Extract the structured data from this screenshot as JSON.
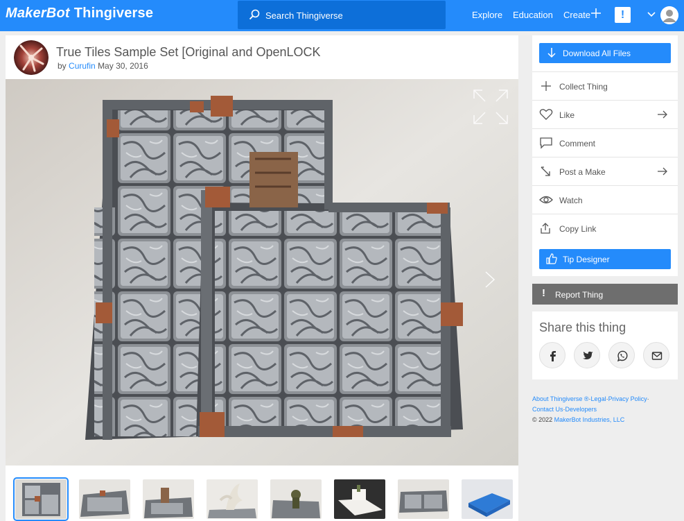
{
  "header": {
    "brand_left": "MakerBot",
    "brand_right": "Thingiverse",
    "search_placeholder": "Search Thingiverse",
    "nav": [
      "Explore",
      "Education",
      "Create"
    ],
    "alert_symbol": "!"
  },
  "thing": {
    "title": "True Tiles Sample Set [Original and OpenLOCK",
    "by": "by",
    "author": "Curufin",
    "date": "May 30, 2016"
  },
  "gallery": {
    "thumbnail_count": 8,
    "active_index": 0
  },
  "sidebar": {
    "download_label": "Download All Files",
    "actions": [
      {
        "label": "Collect Thing",
        "icon": "plus-icon"
      },
      {
        "label": "Like",
        "icon": "heart-icon"
      },
      {
        "label": "Comment",
        "icon": "comment-icon"
      },
      {
        "label": "Post a Make",
        "icon": "make-icon"
      },
      {
        "label": "Watch",
        "icon": "eye-icon"
      },
      {
        "label": "Copy Link",
        "icon": "share-icon"
      }
    ],
    "tip_label": "Tip Designer",
    "report_label": "Report Thing",
    "report_symbol": "!",
    "share_title": "Share this thing",
    "share_icons": [
      "facebook-icon",
      "twitter-icon",
      "whatsapp-icon",
      "email-icon"
    ]
  },
  "footer": {
    "line1_links": [
      "About Thingiverse",
      "®",
      "Legal",
      "Privacy Policy"
    ],
    "line2_links": [
      "Contact Us",
      "Developers"
    ],
    "copyright": "©  2022",
    "company": "MakerBot Industries, LLC"
  },
  "colors": {
    "brand_blue": "#248bfb",
    "search_bg": "#0d6fd9",
    "report_bg": "#6e6e6e",
    "page_bg": "#eeeeee"
  }
}
